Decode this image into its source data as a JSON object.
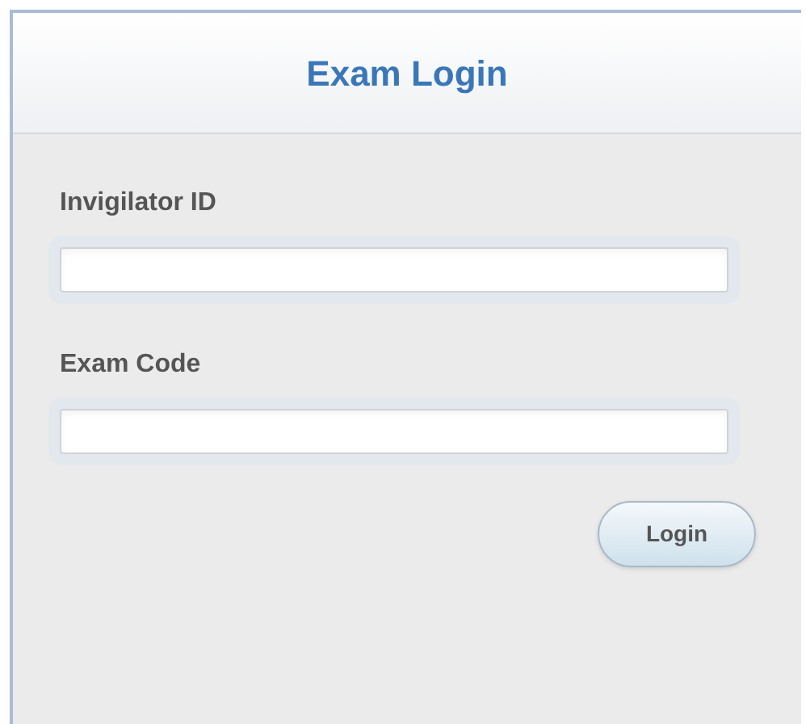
{
  "header": {
    "title": "Exam Login"
  },
  "fields": [
    {
      "label": "Invigilator ID"
    },
    {
      "label": "Exam Code"
    }
  ],
  "buttons": [
    "Login"
  ]
}
